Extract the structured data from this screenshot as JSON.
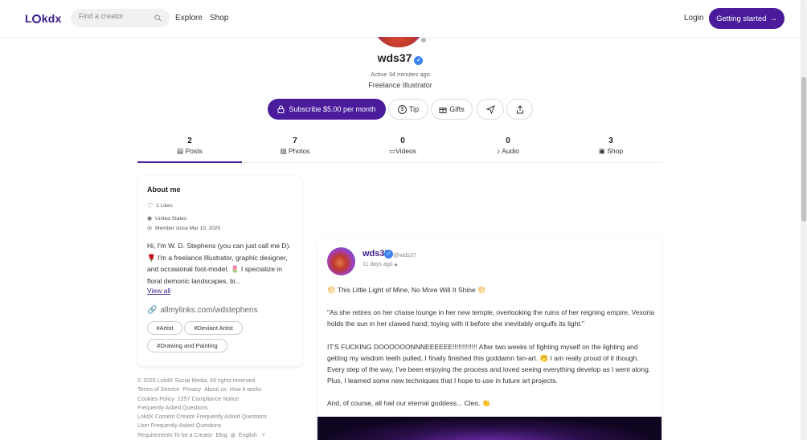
{
  "header": {
    "logo": "Lokdx",
    "search_placeholder": "Find a creator",
    "nav": [
      "Explore",
      "Shop"
    ],
    "login": "Login",
    "cta": "Getting started"
  },
  "profile": {
    "username": "wds37",
    "active": "Active 34 minutes ago",
    "tagline": "Freelance Illustrator",
    "subscribe": "Subscribe $5.00 per month",
    "tip": "Tip",
    "gifts": "Gifts"
  },
  "tabs": [
    {
      "count": "2",
      "label": "Posts"
    },
    {
      "count": "7",
      "label": "Photos"
    },
    {
      "count": "0",
      "label": "Videos"
    },
    {
      "count": "0",
      "label": "Audio"
    },
    {
      "count": "3",
      "label": "Shop"
    }
  ],
  "about": {
    "title": "About me",
    "likes": "1 Likes",
    "location": "United States",
    "member_since": "Member since Mar 10, 2025",
    "text": "Hi, I'm W. D. Stephens (you can just call me D). 🌹 I'm a freelance Illustrator, graphic designer, and occasional foot-model. 🌷 I specialize in floral demonic landscapes, bi...",
    "view_all": "View all",
    "link": "allmylinks.com/wdstephens",
    "tags": [
      "#Artist",
      "#Deviant Artist",
      "#Drawing and Painting"
    ]
  },
  "footer": {
    "copyright": "© 2025 LokdX Social Media, All rights reserved.",
    "links": [
      "Terms of Service",
      "Privacy",
      "About us",
      "How it works",
      "Cookies Policy",
      "2257 Compliance Notice",
      "Frequently Asked Questions",
      "LokdX Content Creator Frequently Asked Questions",
      "User Frequently Asked Questions",
      "Requirements To be a Creator",
      "Blog"
    ],
    "language": "English"
  },
  "post": {
    "name": "wds37",
    "handle": "@wds37",
    "time": "11 days ago",
    "p1": "🌕 This Little Light of Mine, No More Will It Shine 🌕",
    "p2": "\"As she retires on her chaise lounge in her new temple, overlooking the ruins of her reigning empire, Vexoria holds the sun in her clawed hand; toying with it before she inevitably engulfs its light.\"",
    "p3": "IT'S FUCKING DOOOOOONNNEEEEEE!!!!!!!!!!!!! After two weeks of fighting myself on the lighting and getting my wisdom teeth pulled, I finally finished this goddamn fan-art. 🤭 I am really proud of it though. Every step of the way, I've been enjoying the process and loved seeing everything develop as I went along. Plus, I learned some new techniques that I hope to use in future art projects.",
    "p4": "And, of course, all hail our eternal goddess... Cleo. 👏"
  },
  "colors": {
    "brand": "#4a1c9c",
    "verified": "#3b82f6"
  }
}
